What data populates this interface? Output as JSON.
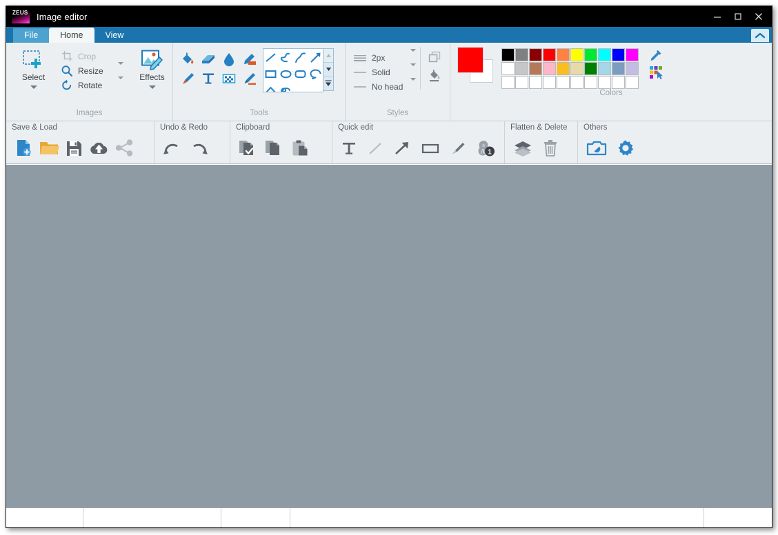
{
  "window": {
    "title": "Image editor",
    "logo_text": "ZEUS",
    "minimize": "minimize-button",
    "maximize": "maximize-button",
    "close": "close-button"
  },
  "tabs": [
    {
      "label": "File",
      "active": false,
      "kind": "file"
    },
    {
      "label": "Home",
      "active": true,
      "kind": "normal"
    },
    {
      "label": "View",
      "active": false,
      "kind": "normal"
    }
  ],
  "ribbon_collapse": {
    "name": "collapse-ribbon-button",
    "icon": "chevron-up-icon"
  },
  "ribbon": {
    "groups": [
      {
        "label": "Images",
        "big_button": {
          "label": "Select",
          "icon": "select-rectangle-add-icon",
          "has_menu": true
        },
        "items": [
          {
            "label": "Crop",
            "icon": "crop-icon",
            "disabled": true,
            "has_menu": false
          },
          {
            "label": "Resize",
            "icon": "resize-magnifier-icon",
            "disabled": false,
            "has_menu": true
          },
          {
            "label": "Rotate",
            "icon": "rotate-icon",
            "disabled": false,
            "has_menu": true
          }
        ],
        "effects": {
          "label": "Effects",
          "icon": "effects-image-pencil-icon",
          "has_menu": true
        }
      },
      {
        "label": "Tools",
        "tools": [
          {
            "name": "fill-bucket-tool",
            "icon": "paint-bucket-icon"
          },
          {
            "name": "eraser-tool",
            "icon": "eraser-icon"
          },
          {
            "name": "blur-tool",
            "icon": "water-drop-icon"
          },
          {
            "name": "highlighter-tool",
            "icon": "marker-highlight-icon"
          },
          {
            "name": "brush-tool",
            "icon": "paintbrush-icon"
          },
          {
            "name": "text-tool",
            "icon": "text-t-icon"
          },
          {
            "name": "pixelate-tool",
            "icon": "pixelate-checker-icon"
          },
          {
            "name": "pencil-tool",
            "icon": "pencil-underline-icon"
          }
        ],
        "shapes": [
          {
            "name": "line-shape",
            "icon": "straight-line-icon"
          },
          {
            "name": "curve-shape",
            "icon": "s-curve-icon"
          },
          {
            "name": "polyline-shape",
            "icon": "bent-line-icon"
          },
          {
            "name": "arrow-shape",
            "icon": "arrow-diagonal-icon"
          },
          {
            "name": "rectangle-shape",
            "icon": "rectangle-icon"
          },
          {
            "name": "ellipse-shape",
            "icon": "ellipse-icon"
          },
          {
            "name": "rounded-rectangle-shape",
            "icon": "rounded-rectangle-icon"
          },
          {
            "name": "speech-bubble-shape",
            "icon": "speech-bubble-icon"
          },
          {
            "name": "chevron-shape",
            "icon": "chevron-up-shape-icon"
          },
          {
            "name": "scribble-shape",
            "icon": "scribble-icon"
          }
        ],
        "gallery_scroll": [
          "scroll-up-icon",
          "scroll-down-icon",
          "open-gallery-icon"
        ]
      },
      {
        "label": "Styles",
        "rows": [
          {
            "value": "2px",
            "icon": "line-thickness-icon",
            "name": "stroke-width-dropdown"
          },
          {
            "value": "Solid",
            "icon": "line-style-icon",
            "name": "line-style-dropdown"
          },
          {
            "value": "No head",
            "icon": "arrow-head-icon",
            "name": "arrow-head-dropdown"
          }
        ],
        "side_buttons": [
          {
            "name": "shape-outline-button",
            "icon": "square-outline-icon"
          },
          {
            "name": "shape-fill-button",
            "icon": "fill-bucket-gray-icon"
          }
        ]
      },
      {
        "label": "Colors",
        "foreground": "#ff0000",
        "background": "#ffffff",
        "palette_rows": [
          [
            "#000000",
            "#808080",
            "#8b0000",
            "#ff0000",
            "#ff8243",
            "#ffff00",
            "#00e832",
            "#00ffff",
            "#0000ff",
            "#ff00ff"
          ],
          [
            "#ffffff",
            "#c6c6c6",
            "#b5795a",
            "#ffb6c8",
            "#fcbe1e",
            "#e8daa6",
            "#008000",
            "#a4d8e8",
            "#7c9cc0",
            "#c4bde3"
          ],
          [
            "#ffffff",
            "#ffffff",
            "#ffffff",
            "#ffffff",
            "#ffffff",
            "#ffffff",
            "#ffffff",
            "#ffffff",
            "#ffffff",
            "#ffffff"
          ]
        ],
        "tools": [
          {
            "name": "color-picker-eyedropper-button",
            "icon": "eyedropper-icon"
          },
          {
            "name": "edit-colors-button",
            "icon": "color-palette-cursor-icon"
          }
        ]
      }
    ]
  },
  "toolbar2": {
    "groups": [
      {
        "label": "Save & Load",
        "items": [
          {
            "name": "new-image-button",
            "icon": "new-document-plus-icon"
          },
          {
            "name": "open-file-button",
            "icon": "folder-open-icon"
          },
          {
            "name": "save-button",
            "icon": "floppy-disk-icon"
          },
          {
            "name": "upload-cloud-button",
            "icon": "cloud-upload-icon"
          },
          {
            "name": "share-button",
            "icon": "share-nodes-icon"
          }
        ]
      },
      {
        "label": "Undo & Redo",
        "items": [
          {
            "name": "undo-button",
            "icon": "undo-arrow-icon"
          },
          {
            "name": "redo-button",
            "icon": "redo-arrow-icon"
          }
        ]
      },
      {
        "label": "Clipboard",
        "items": [
          {
            "name": "copy-check-button",
            "icon": "copy-check-icon"
          },
          {
            "name": "copy-button",
            "icon": "copy-pages-icon"
          },
          {
            "name": "paste-button",
            "icon": "clipboard-paste-icon"
          }
        ]
      },
      {
        "label": "Quick edit",
        "items": [
          {
            "name": "quick-text-button",
            "icon": "text-t-icon"
          },
          {
            "name": "quick-line-button",
            "icon": "straight-line-icon"
          },
          {
            "name": "quick-arrow-button",
            "icon": "arrow-diagonal-icon"
          },
          {
            "name": "quick-rectangle-button",
            "icon": "rectangle-icon"
          },
          {
            "name": "quick-brush-button",
            "icon": "paintbrush-gray-icon"
          },
          {
            "name": "quick-step-number-button",
            "icon": "step-number-badge-icon"
          }
        ]
      },
      {
        "label": "Flatten & Delete",
        "items": [
          {
            "name": "flatten-layers-button",
            "icon": "layers-stack-icon"
          },
          {
            "name": "delete-button",
            "icon": "trash-can-icon"
          }
        ]
      },
      {
        "label": "Others",
        "items": [
          {
            "name": "screenshot-button",
            "icon": "camera-icon"
          },
          {
            "name": "settings-button",
            "icon": "gear-icon"
          }
        ]
      }
    ]
  },
  "canvas": {
    "background": "#8e9aa4"
  },
  "statusbar": {
    "cells": [
      "",
      "",
      "",
      "",
      ""
    ]
  }
}
